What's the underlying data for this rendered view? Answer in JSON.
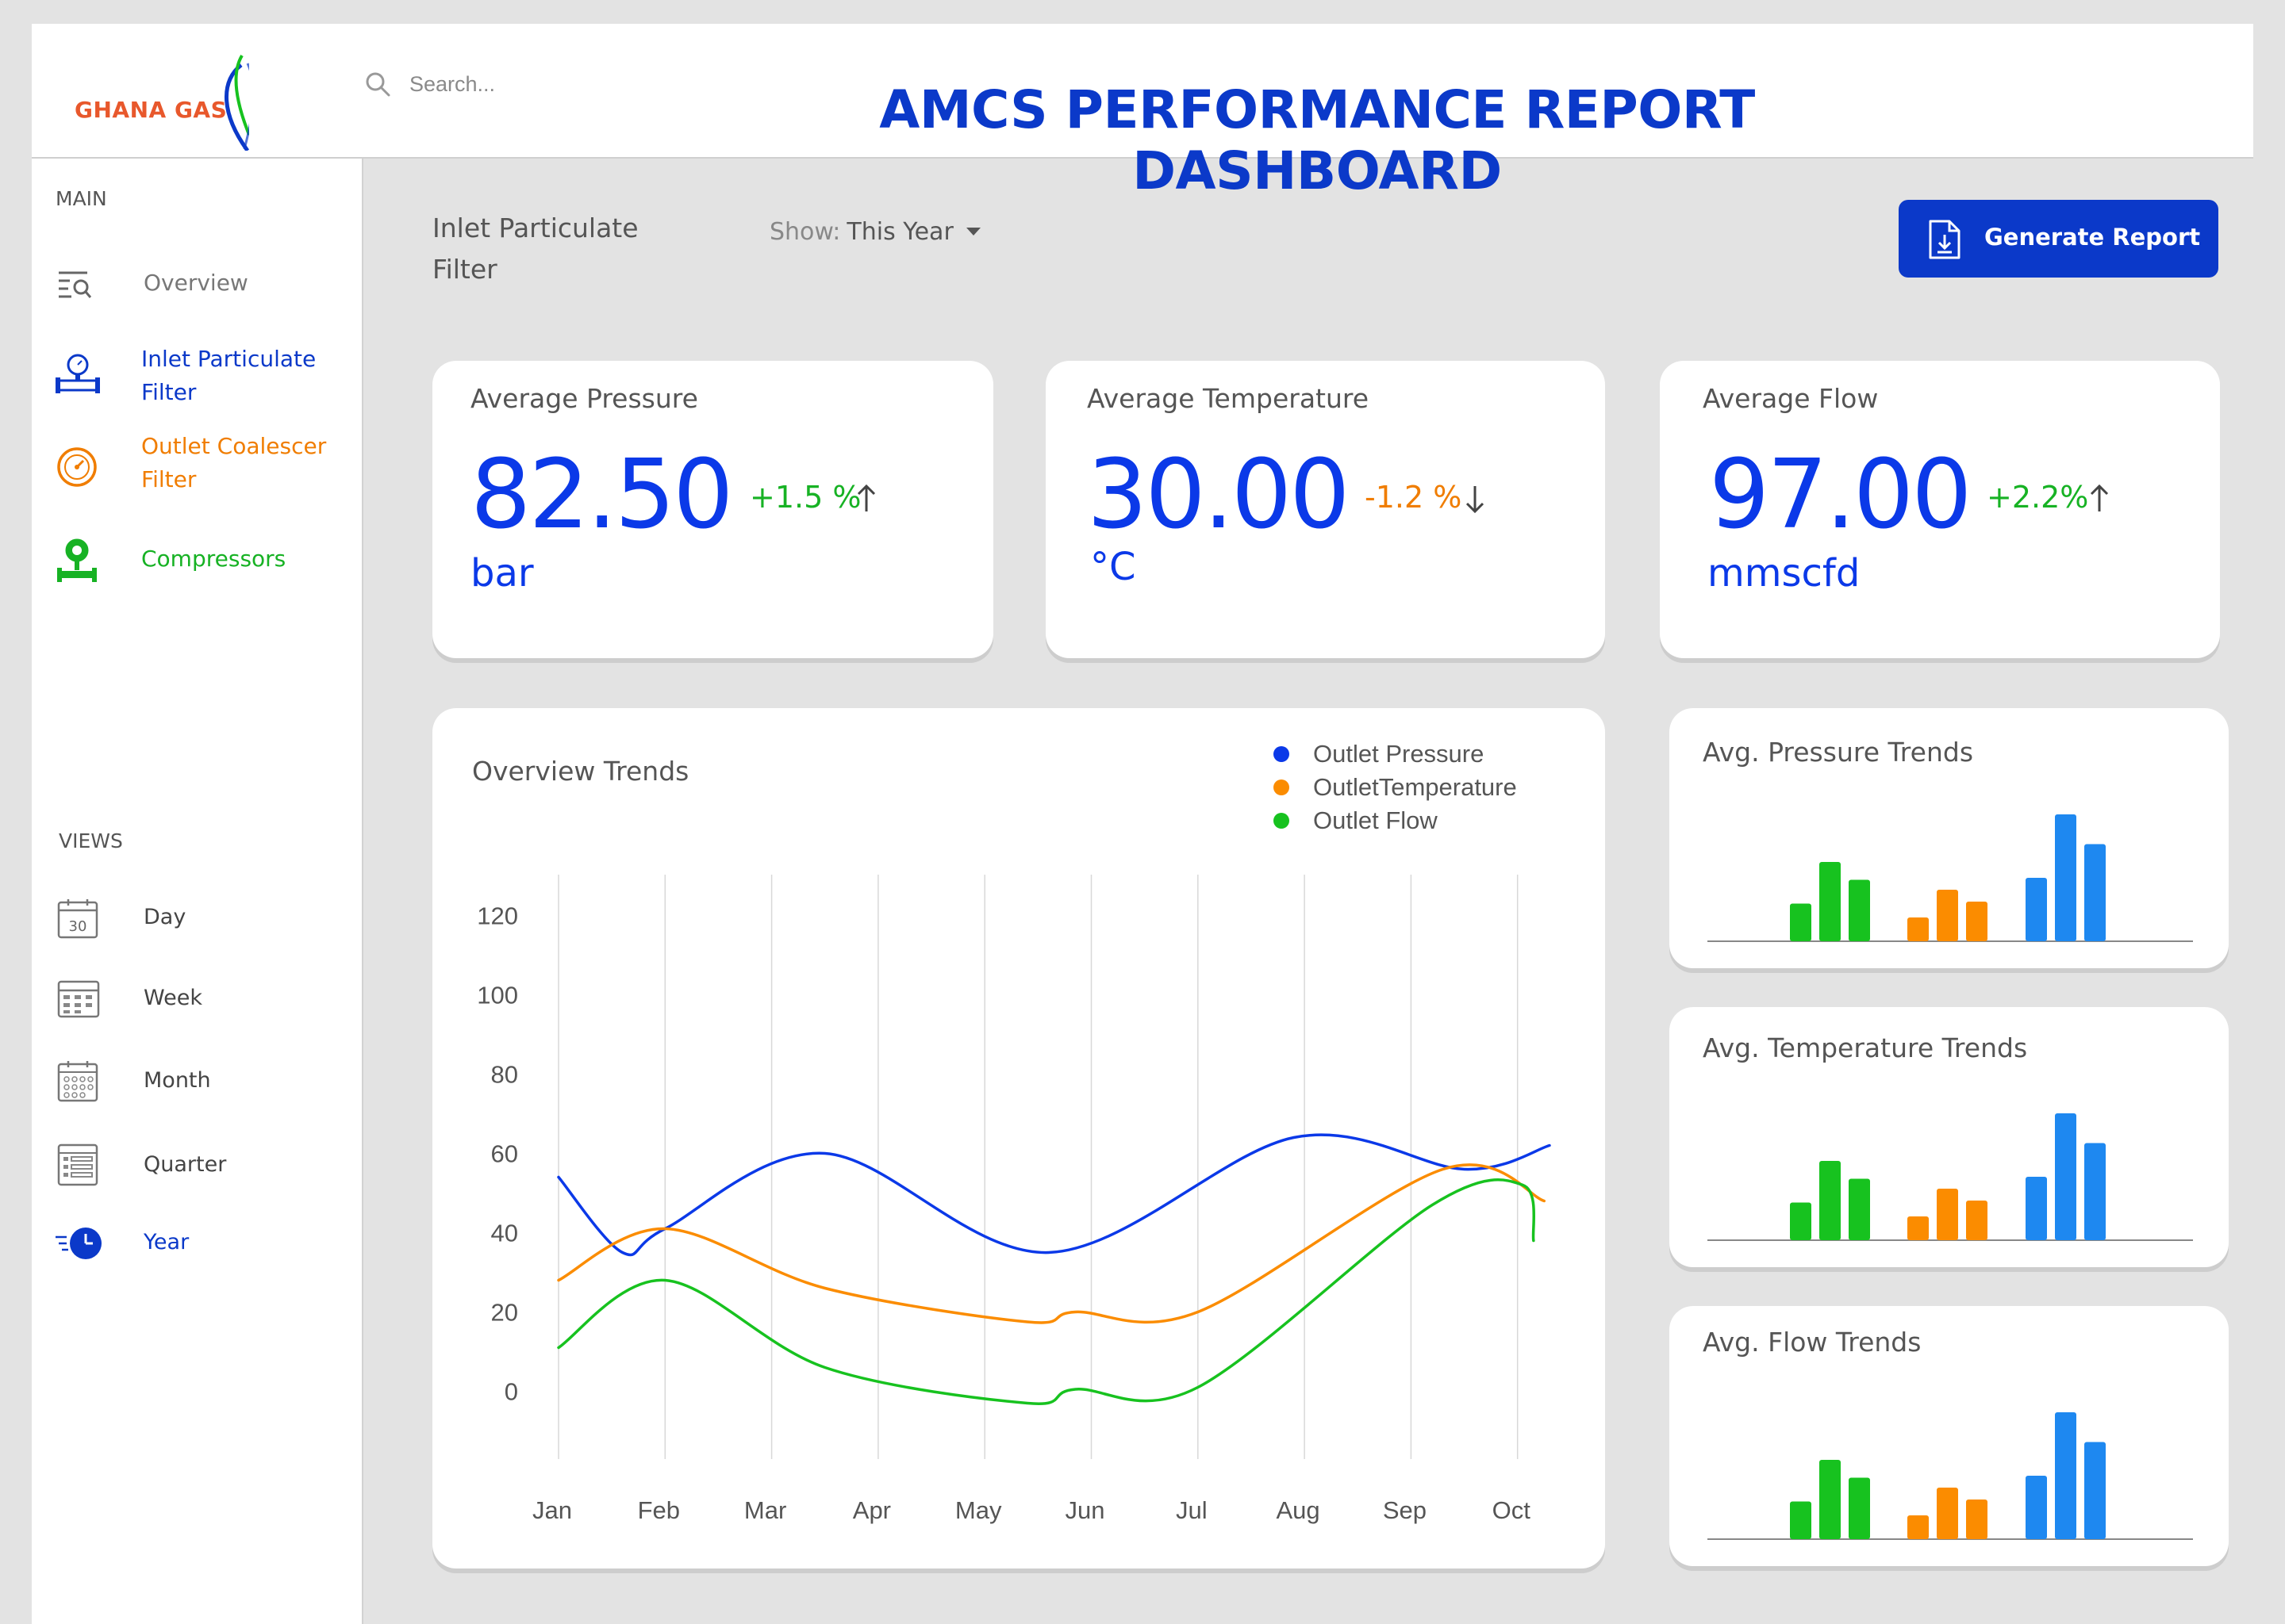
{
  "header": {
    "brand": "GHANA GAS",
    "title": "AMCS PERFORMANCE REPORT DASHBOARD",
    "search_placeholder": "Search..."
  },
  "sidebar": {
    "main_label": "MAIN",
    "main_items": [
      {
        "label": "Overview",
        "icon": "overview-search-icon",
        "color": "#777777"
      },
      {
        "label": "Inlet Particulate Filter",
        "icon": "pressure-gauge-pipe-icon",
        "color": "#0b39c9"
      },
      {
        "label": "Outlet Coalescer Filter",
        "icon": "gauge-dial-icon",
        "color": "#f07d00"
      },
      {
        "label": "Compressors",
        "icon": "compressor-valve-icon",
        "color": "#17b224"
      }
    ],
    "views_label": "VIEWS",
    "view_items": [
      {
        "label": "Day",
        "icon": "calendar-day-icon",
        "badge": "30"
      },
      {
        "label": "Week",
        "icon": "calendar-week-icon"
      },
      {
        "label": "Month",
        "icon": "calendar-month-icon"
      },
      {
        "label": "Quarter",
        "icon": "calendar-quarter-icon"
      },
      {
        "label": "Year",
        "icon": "clock-fast-icon",
        "active": true
      }
    ]
  },
  "main": {
    "section_name": "Inlet Particulate Filter",
    "show_prefix": "Show:",
    "show_value": "This Year",
    "generate_button": "Generate Report"
  },
  "kpis": [
    {
      "title": "Average Pressure",
      "value": "82.50",
      "change": "+1.5 %",
      "direction": "up",
      "unit": "bar",
      "change_color": "#17b224"
    },
    {
      "title": "Average Temperature",
      "value": "30.00",
      "change": "-1.2 %",
      "direction": "down",
      "unit": "°C",
      "change_color": "#f07d00"
    },
    {
      "title": "Average Flow",
      "value": "97.00",
      "change": "+2.2%",
      "direction": "up",
      "unit": "mmscfd",
      "change_color": "#17b224"
    }
  ],
  "colors": {
    "blue": "#0b39e8",
    "orange": "#fb8c00",
    "green": "#17c21f",
    "bright_blue": "#1e88f0",
    "brand_blue": "#0b39c9"
  },
  "chart_data": [
    {
      "type": "line",
      "title": "Overview Trends",
      "categories": [
        "Jan",
        "Feb",
        "Mar",
        "Apr",
        "May",
        "Jun",
        "Jul",
        "Aug",
        "Sep",
        "Oct"
      ],
      "y_ticks": [
        120,
        100,
        80,
        60,
        40,
        20,
        0
      ],
      "ylim": [
        -15,
        130
      ],
      "grid": "vertical",
      "legend_position": "top-right",
      "series": [
        {
          "name": "Outlet Pressure",
          "color": "#0b39e8",
          "x": [
            0,
            0.6,
            1,
            2.5,
            4.6,
            6.9,
            8.5,
            9.3
          ],
          "values": [
            54,
            35,
            41,
            60,
            35,
            64,
            56,
            62
          ]
        },
        {
          "name": "OutletTemperature",
          "color": "#fb8c00",
          "x": [
            0,
            1,
            2.5,
            4.4,
            4.85,
            6.0,
            8.3,
            9.25
          ],
          "values": [
            28,
            41,
            26,
            17.5,
            20,
            20,
            56,
            48
          ]
        },
        {
          "name": "Outlet Flow",
          "color": "#17c21f",
          "x": [
            0,
            1,
            2.5,
            4.4,
            4.85,
            6.0,
            8.2,
            9.05,
            9.15
          ],
          "values": [
            11,
            28,
            6,
            -3,
            0.5,
            1,
            47,
            52,
            38
          ]
        }
      ]
    },
    {
      "type": "bar",
      "title": "Avg. Pressure Trends",
      "groups": [
        {
          "color": "#17c21f",
          "values": [
            19,
            40,
            31
          ]
        },
        {
          "color": "#fb8c00",
          "values": [
            12,
            26,
            20
          ]
        },
        {
          "color": "#1e88f0",
          "values": [
            32,
            64,
            49
          ]
        }
      ]
    },
    {
      "type": "bar",
      "title": "Avg. Temperature Trends",
      "groups": [
        {
          "color": "#17c21f",
          "values": [
            19,
            40,
            31
          ]
        },
        {
          "color": "#fb8c00",
          "values": [
            12,
            26,
            20
          ]
        },
        {
          "color": "#1e88f0",
          "values": [
            32,
            64,
            49
          ]
        }
      ]
    },
    {
      "type": "bar",
      "title": "Avg. Flow Trends",
      "groups": [
        {
          "color": "#17c21f",
          "values": [
            19,
            40,
            31
          ]
        },
        {
          "color": "#fb8c00",
          "values": [
            12,
            26,
            20
          ]
        },
        {
          "color": "#1e88f0",
          "values": [
            32,
            64,
            49
          ]
        }
      ]
    }
  ]
}
